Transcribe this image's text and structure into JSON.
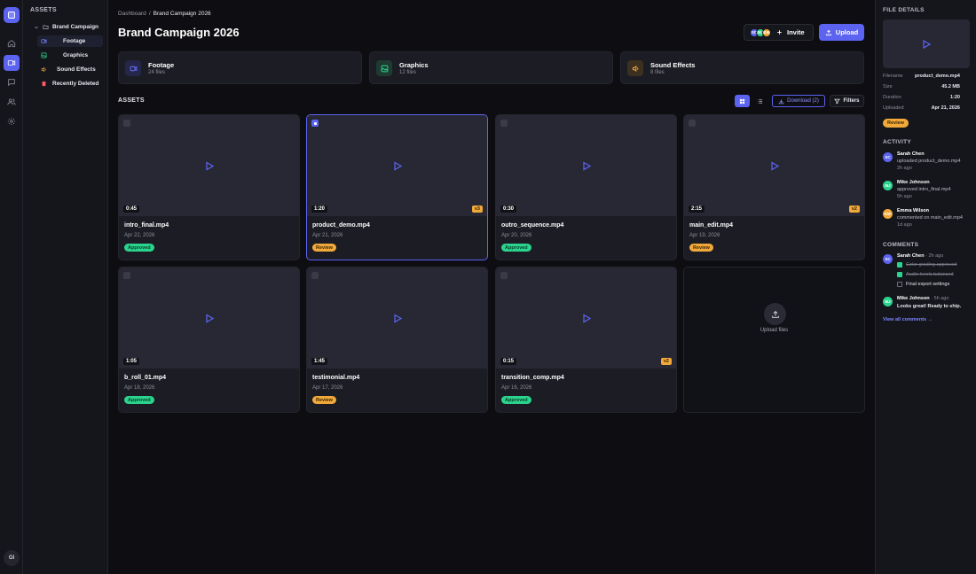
{
  "user": {
    "initials": "GI"
  },
  "tree": {
    "header": "ASSETS",
    "root": "Brand Campaign",
    "items": [
      {
        "label": "Footage",
        "icon": "video-icon",
        "color": "#7b83ff"
      },
      {
        "label": "Graphics",
        "icon": "image-icon",
        "color": "#2bd48e"
      },
      {
        "label": "Sound Effects",
        "icon": "speaker-icon",
        "color": "#f2a93b"
      },
      {
        "label": "Recently Deleted",
        "icon": "trash-icon",
        "color": "#ff5a6a"
      }
    ]
  },
  "header": {
    "breadcrumb_root": "Dashboard",
    "breadcrumb_sep": "/",
    "breadcrumb_current": "Brand Campaign 2026",
    "title": "Brand Campaign 2026",
    "avatars": [
      {
        "initials": "SC",
        "color": "#5b63f0"
      },
      {
        "initials": "MJ",
        "color": "#2bd48e"
      },
      {
        "initials": "EW",
        "color": "#f2a93b"
      }
    ],
    "invite_label": "Invite",
    "upload_label": "Upload"
  },
  "categories": [
    {
      "name": "Footage",
      "count": "24 files",
      "icon": "video-icon",
      "color": "#6a72ff",
      "bg": "#252748"
    },
    {
      "name": "Graphics",
      "count": "12 files",
      "icon": "image-icon",
      "color": "#2bd48e",
      "bg": "#1e3a31"
    },
    {
      "name": "Sound Effects",
      "count": "8 files",
      "icon": "speaker-icon",
      "color": "#f2a93b",
      "bg": "#3c3021"
    }
  ],
  "toolbar": {
    "section_title": "ASSETS",
    "download_label": "Download (2)",
    "filters_label": "Filters"
  },
  "assets": [
    {
      "name": "intro_final.mp4",
      "date": "Apr 22, 2026",
      "duration": "0:45",
      "version": "",
      "status": "Approved",
      "selected": false
    },
    {
      "name": "product_demo.mp4",
      "date": "Apr 21, 2026",
      "duration": "1:20",
      "version": "v3",
      "status": "Review",
      "selected": true
    },
    {
      "name": "outro_sequence.mp4",
      "date": "Apr 20, 2026",
      "duration": "0:30",
      "version": "",
      "status": "Approved",
      "selected": false
    },
    {
      "name": "main_edit.mp4",
      "date": "Apr 19, 2026",
      "duration": "2:15",
      "version": "v2",
      "status": "Review",
      "selected": false
    },
    {
      "name": "b_roll_01.mp4",
      "date": "Apr 18, 2026",
      "duration": "1:05",
      "version": "",
      "status": "Approved",
      "selected": false
    },
    {
      "name": "testimonial.mp4",
      "date": "Apr 17, 2026",
      "duration": "1:45",
      "version": "",
      "status": "Review",
      "selected": false
    },
    {
      "name": "transition_comp.mp4",
      "date": "Apr 16, 2026",
      "duration": "0:15",
      "version": "v2",
      "status": "Approved",
      "selected": false
    }
  ],
  "upload_zone": {
    "label": "Upload files"
  },
  "details": {
    "header": "FILE DETAILS",
    "fields": [
      {
        "key": "Filename",
        "value": "product_demo.mp4"
      },
      {
        "key": "Size",
        "value": "45.2 MB"
      },
      {
        "key": "Duration",
        "value": "1:20"
      },
      {
        "key": "Uploaded",
        "value": "Apr 21, 2026"
      }
    ],
    "status": "Review"
  },
  "activity": {
    "header": "ACTIVITY",
    "items": [
      {
        "initials": "SC",
        "color": "#5b63f0",
        "name": "Sarah Chen",
        "text": "uploaded product_demo.mp4",
        "time": "2h ago"
      },
      {
        "initials": "MJ",
        "color": "#2bd48e",
        "name": "Mike Johnson",
        "text": "approved intro_final.mp4",
        "time": "5h ago"
      },
      {
        "initials": "EW",
        "color": "#f2a93b",
        "name": "Emma Wilson",
        "text": "commented on main_edit.mp4",
        "time": "1d ago"
      }
    ]
  },
  "comments": {
    "header": "COMMENTS",
    "items": [
      {
        "initials": "SC",
        "color": "#5b63f0",
        "name": "Sarah Chen",
        "time": "· 2h ago",
        "checklist": [
          {
            "label": "Color grading approved",
            "done": true
          },
          {
            "label": "Audio levels balanced",
            "done": true
          },
          {
            "label": "Final export settings",
            "done": false
          }
        ]
      },
      {
        "initials": "MJ",
        "color": "#2bd48e",
        "name": "Mike Johnson",
        "time": "· 5h ago",
        "text": "Looks great! Ready to ship."
      }
    ],
    "view_all": "View all comments →"
  }
}
